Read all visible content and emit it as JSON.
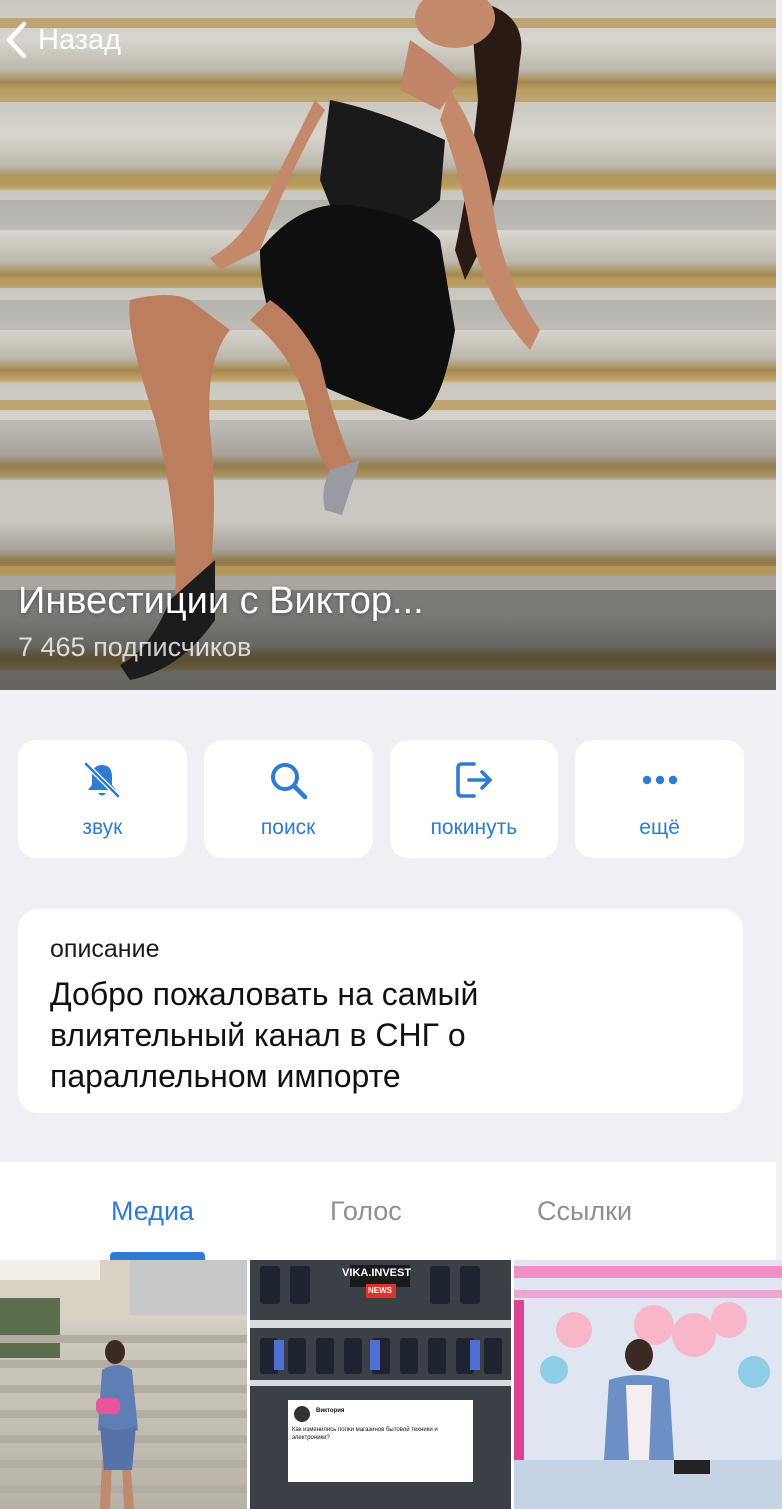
{
  "header": {
    "back_label": "Назад",
    "channel_title": "Инвестиции с Виктор...",
    "subscribers": "7 465 подписчиков"
  },
  "actions": [
    {
      "label": "звук",
      "icon": "bell-slash-icon"
    },
    {
      "label": "поиск",
      "icon": "search-icon"
    },
    {
      "label": "покинуть",
      "icon": "leave-icon"
    },
    {
      "label": "ещё",
      "icon": "more-icon"
    }
  ],
  "description": {
    "label": "описание",
    "text": "Добро пожаловать на самый влиятельный канал в СНГ о параллельном импорте"
  },
  "tabs": [
    {
      "label": "Медиа",
      "active": true
    },
    {
      "label": "Голос",
      "active": false
    },
    {
      "label": "Ссылки",
      "active": false
    }
  ],
  "media": {
    "thumb2_brand": "VIKA.INVEST",
    "thumb2_badge": "NEWS",
    "thumb2_author": "Виктория",
    "thumb2_post": "Как изменились полки магазинов бытовой техники и электроники?"
  },
  "colors": {
    "accent": "#2d7bd2",
    "background": "#efeff4",
    "card": "#ffffff"
  }
}
